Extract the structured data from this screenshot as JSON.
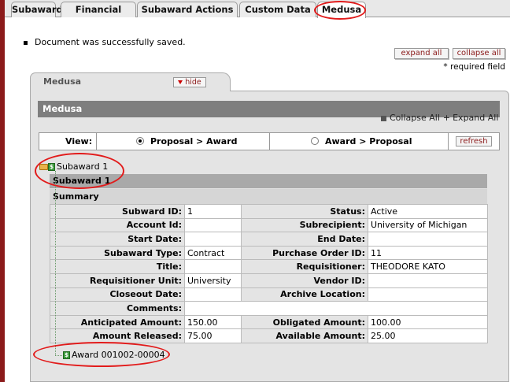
{
  "tabs": [
    {
      "label": "Subaward"
    },
    {
      "label": "Financial"
    },
    {
      "label": "Subaward Actions"
    },
    {
      "label": "Custom Data"
    },
    {
      "label": "Medusa"
    }
  ],
  "message": "Document was successfully saved.",
  "buttons": {
    "expand_all": "expand all",
    "collapse_all": "collapse all",
    "hide": "hide",
    "refresh": "refresh"
  },
  "required_field": "* required field",
  "panel": {
    "tab_title": "Medusa",
    "header": "Medusa",
    "collapse_all": "Collapse All",
    "expand_all": "Expand All"
  },
  "view": {
    "label": "View:",
    "options": [
      "Proposal > Award",
      "Award > Proposal"
    ],
    "selected": "Proposal > Award"
  },
  "tree": {
    "root": "Subaward 1",
    "child": "Award 001002-00004"
  },
  "subaward": {
    "title": "Subaward 1",
    "section": "Summary",
    "rows": [
      {
        "l1": "Subward ID:",
        "v1": "1",
        "l2": "Status:",
        "v2": "Active"
      },
      {
        "l1": "Account Id:",
        "v1": "",
        "l2": "Subrecipient:",
        "v2": "University of Michigan"
      },
      {
        "l1": "Start Date:",
        "v1": "",
        "l2": "End Date:",
        "v2": ""
      },
      {
        "l1": "Subaward Type:",
        "v1": "Contract",
        "l2": "Purchase Order ID:",
        "v2": "11"
      },
      {
        "l1": "Title:",
        "v1": "",
        "l2": "Requisitioner:",
        "v2": "THEODORE KATO"
      },
      {
        "l1": "Requisitioner Unit:",
        "v1": "University",
        "l2": "Vendor ID:",
        "v2": ""
      },
      {
        "l1": "Closeout Date:",
        "v1": "",
        "l2": "Archive Location:",
        "v2": ""
      },
      {
        "l1": "Anticipated Amount:",
        "v1": "150.00",
        "l2": "Obligated Amount:",
        "v2": "100.00"
      },
      {
        "l1": "Amount Released:",
        "v1": "75.00",
        "l2": "Available Amount:",
        "v2": "25.00"
      }
    ],
    "comments_label": "Comments:",
    "comments_value": ""
  },
  "colors": {
    "brand": "#8b1a1a",
    "annotation": "#e21b1b"
  }
}
